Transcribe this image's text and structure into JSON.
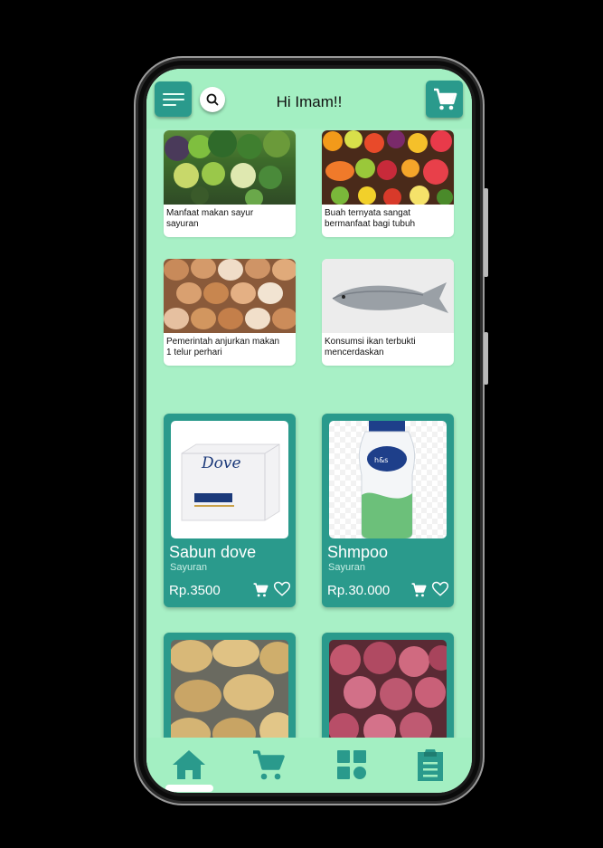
{
  "app": {
    "greeting": "Hi Imam!!"
  },
  "colors": {
    "accent": "#2a9a8c",
    "screen_bg": "#a8f0c6",
    "bar_bg": "#a3efc2",
    "card_bg": "#ffffff"
  },
  "header": {
    "menu_icon": "hamburger-menu-icon",
    "search_icon": "search-icon",
    "cart_icon": "cart-icon"
  },
  "articles": [
    {
      "caption": "Manfaat makan sayur sayuran",
      "image": "vegetables-photo"
    },
    {
      "caption": "Buah ternyata sangat bermanfaat bagi tubuh",
      "image": "fruits-photo"
    },
    {
      "caption": "Pemerintah anjurkan makan 1 telur perhari",
      "image": "eggs-photo"
    },
    {
      "caption": "Konsumsi ikan terbukti mencerdaskan",
      "image": "fish-photo"
    }
  ],
  "products": [
    {
      "name": "Sabun dove",
      "category": "Sayuran",
      "price": "Rp.3500",
      "image": "dove-soap-photo"
    },
    {
      "name": "Shmpoo",
      "category": "Sayuran",
      "price": "Rp.30.000",
      "image": "shampoo-bottle-photo"
    },
    {
      "image": "potatoes-photo"
    },
    {
      "image": "red-onions-photo"
    }
  ],
  "bottom_nav": [
    {
      "icon": "home-icon",
      "active": true
    },
    {
      "icon": "cart-icon",
      "active": false
    },
    {
      "icon": "grid-icon",
      "active": false
    },
    {
      "icon": "clipboard-icon",
      "active": false
    }
  ]
}
